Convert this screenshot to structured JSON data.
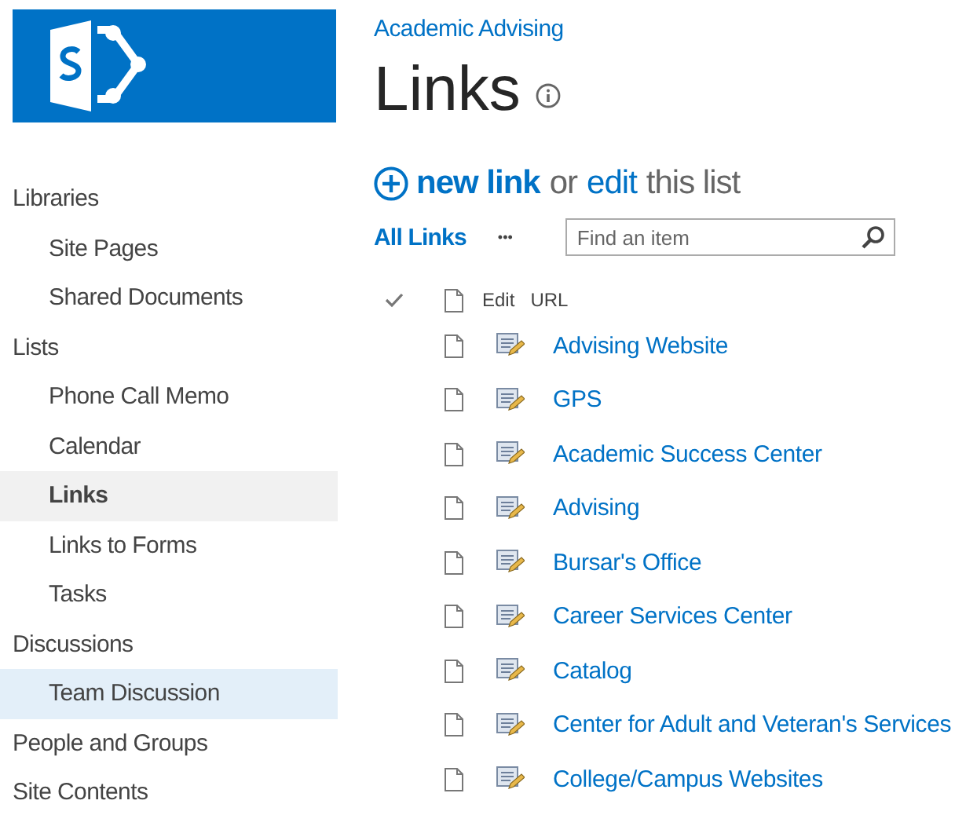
{
  "site_title": "Academic Advising",
  "page_title": "Links",
  "sidebar": {
    "items": [
      {
        "label": "Libraries",
        "kind": "heading",
        "selected": false,
        "hovered": false
      },
      {
        "label": "Site Pages",
        "kind": "sub",
        "selected": false,
        "hovered": false
      },
      {
        "label": "Shared Documents",
        "kind": "sub",
        "selected": false,
        "hovered": false
      },
      {
        "label": "Lists",
        "kind": "heading",
        "selected": false,
        "hovered": false
      },
      {
        "label": "Phone Call Memo",
        "kind": "sub",
        "selected": false,
        "hovered": false
      },
      {
        "label": "Calendar",
        "kind": "sub",
        "selected": false,
        "hovered": false
      },
      {
        "label": "Links",
        "kind": "sub",
        "selected": true,
        "hovered": false
      },
      {
        "label": "Links to Forms",
        "kind": "sub",
        "selected": false,
        "hovered": false
      },
      {
        "label": "Tasks",
        "kind": "sub",
        "selected": false,
        "hovered": false
      },
      {
        "label": "Discussions",
        "kind": "heading",
        "selected": false,
        "hovered": false
      },
      {
        "label": "Team Discussion",
        "kind": "sub",
        "selected": false,
        "hovered": true
      },
      {
        "label": "People and Groups",
        "kind": "heading",
        "selected": false,
        "hovered": false
      },
      {
        "label": "Site Contents",
        "kind": "heading",
        "selected": false,
        "hovered": false
      }
    ]
  },
  "actions": {
    "new_link": "new link",
    "or": "or",
    "edit": "edit",
    "this_list": "this list"
  },
  "view": {
    "label": "All Links",
    "more": "•••"
  },
  "search": {
    "placeholder": "Find an item"
  },
  "table": {
    "columns": [
      "Edit",
      "URL"
    ],
    "rows": [
      {
        "url": "Advising Website"
      },
      {
        "url": "GPS"
      },
      {
        "url": "Academic Success Center"
      },
      {
        "url": "Advising"
      },
      {
        "url": "Bursar's Office"
      },
      {
        "url": "Career Services Center"
      },
      {
        "url": "Catalog"
      },
      {
        "url": "Center for Adult and Veteran's Services"
      },
      {
        "url": "College/Campus Websites"
      }
    ]
  }
}
